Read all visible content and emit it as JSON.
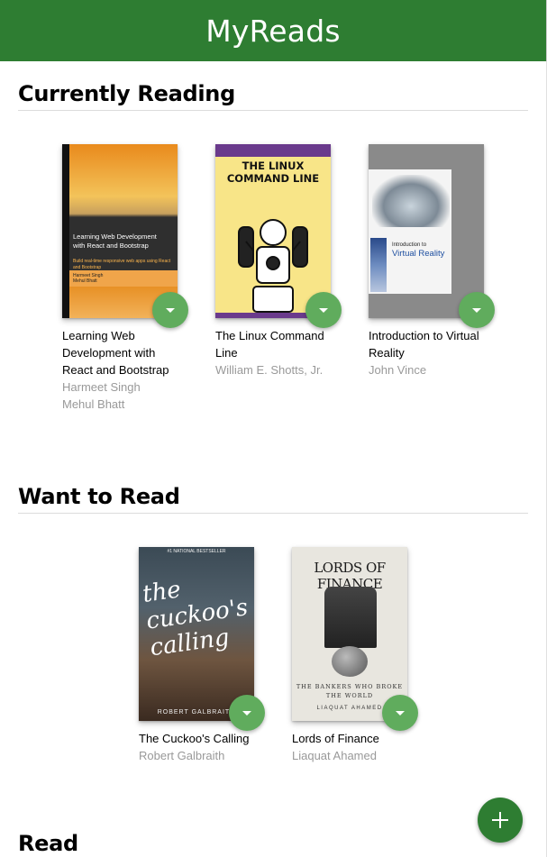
{
  "header": {
    "title": "MyReads"
  },
  "shelves": [
    {
      "title": "Currently Reading",
      "books": [
        {
          "title": "Learning Web Development with React and Bootstrap",
          "authors": [
            "Harmeet Singh",
            "Mehul Bhatt"
          ],
          "cover": {
            "title": "Learning Web Development with React and Bootstrap",
            "subtitle": "Build real-time responsive web apps using React and Bootstrap",
            "authors": "Harmeet Singh\nMehul Bhatt"
          }
        },
        {
          "title": "The Linux Command Line",
          "authors": [
            "William E. Shotts, Jr."
          ],
          "cover": {
            "title": "THE LINUX COMMAND LINE"
          }
        },
        {
          "title": "Introduction to Virtual Reality",
          "authors": [
            "John Vince"
          ],
          "cover": {
            "small": "Introduction to",
            "title": "Virtual Reality"
          }
        }
      ]
    },
    {
      "title": "Want to Read",
      "books": [
        {
          "title": "The Cuckoo's Calling",
          "authors": [
            "Robert Galbraith"
          ],
          "cover": {
            "top": "#1 NATIONAL BESTSELLER",
            "title": "the cuckoo's calling",
            "author": "ROBERT GALBRAITH"
          }
        },
        {
          "title": "Lords of Finance",
          "authors": [
            "Liaquat Ahamed"
          ],
          "cover": {
            "title": "LORDS OF FINANCE",
            "subtitle": "THE BANKERS WHO BROKE THE WORLD",
            "author": "LIAQUAT AHAMED"
          }
        }
      ]
    },
    {
      "title": "Read",
      "books": []
    }
  ],
  "icons": {
    "shelf_changer": "triangle-down-icon",
    "add": "plus-icon"
  },
  "colors": {
    "header_bg": "#2e7d32",
    "changer_bg": "#60ac5d",
    "add_bg": "#2e7d32"
  }
}
